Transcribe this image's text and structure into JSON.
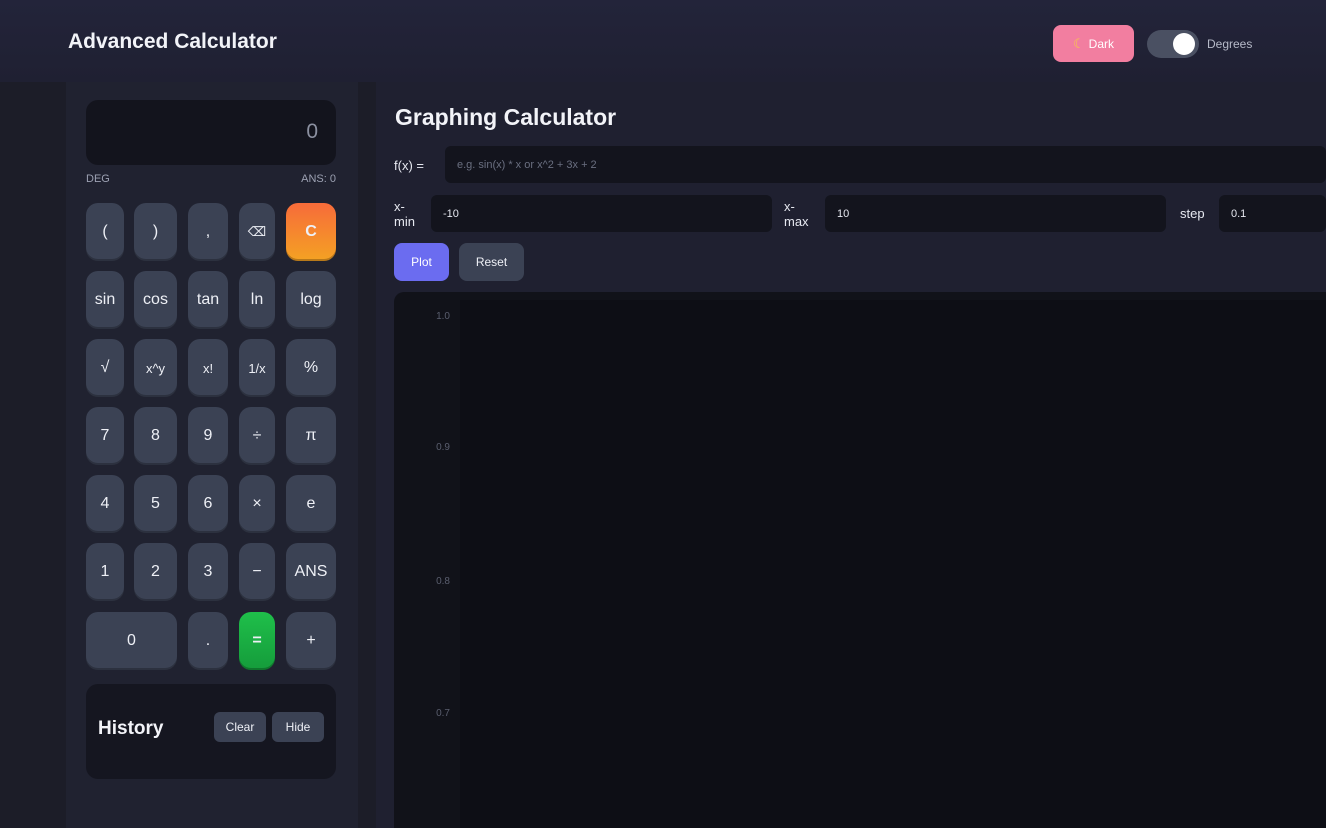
{
  "app": {
    "title": "Advanced Calculator"
  },
  "header": {
    "theme_label": "Dark",
    "theme_icon": "moon-icon",
    "angle_mode_label": "Degrees",
    "angle_toggle_on": true
  },
  "calculator": {
    "display": "0",
    "mode": "DEG",
    "ans": "ANS: 0",
    "keys": {
      "lparen": "(",
      "rparen": ")",
      "comma": ",",
      "backspace": "⌫",
      "clear": "C",
      "sin": "sin",
      "cos": "cos",
      "tan": "tan",
      "ln": "ln",
      "log": "log",
      "sqrt": "√",
      "pow": "x^y",
      "fact": "x!",
      "recip": "1/x",
      "percent": "%",
      "seven": "7",
      "eight": "8",
      "nine": "9",
      "divide": "÷",
      "pi": "π",
      "four": "4",
      "five": "5",
      "six": "6",
      "multiply": "×",
      "e": "e",
      "one": "1",
      "two": "2",
      "three": "3",
      "minus": "−",
      "ans": "ANS",
      "zero": "0",
      "dot": ".",
      "equals": "=",
      "plus": "+"
    },
    "history": {
      "title": "History",
      "clear_label": "Clear",
      "hide_label": "Hide"
    }
  },
  "graph": {
    "title": "Graphing Calculator",
    "fx_label": "f(x) =",
    "fx_placeholder": "e.g. sin(x) * x or x^2 + 3x + 2",
    "xmin_label_line1": "x-",
    "xmin_label_line2": "min",
    "xmin_value": "-10",
    "xmax_label_line1": "x-",
    "xmax_label_line2": "max",
    "xmax_value": "10",
    "step_label": "step",
    "step_value": "0.1",
    "plot_label": "Plot",
    "reset_label": "Reset",
    "yticks": [
      "1.0",
      "0.9",
      "0.8",
      "0.7"
    ]
  },
  "colors": {
    "accent": "#6b6cf0",
    "clear_key": "#f76b3a",
    "equals_key": "#1fbf4a",
    "theme_button": "#f27ea0"
  }
}
